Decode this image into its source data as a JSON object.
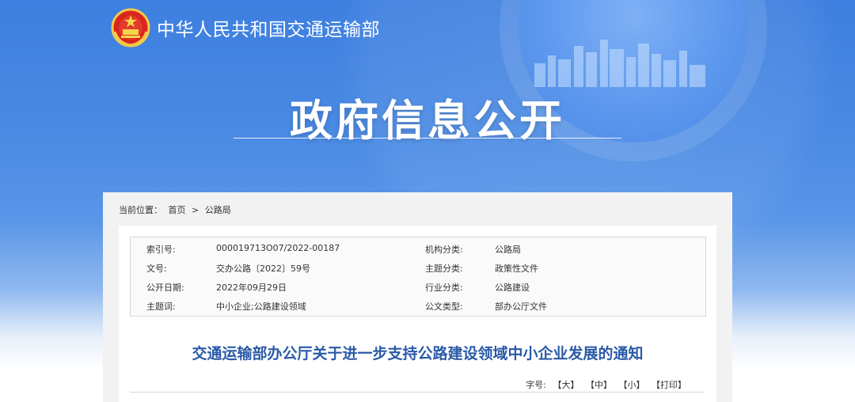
{
  "header": {
    "ministry": "中华人民共和国交通运输部",
    "banner_title": "政府信息公开"
  },
  "breadcrumb": {
    "prefix": "当前位置：",
    "home": "首页",
    "separator": ">",
    "current": "公路局"
  },
  "meta": {
    "index_label": "索引号:",
    "index_value": "000019713O07/2022-00187",
    "org_label": "机构分类:",
    "org_value": "公路局",
    "docno_label": "文号:",
    "docno_value": "交办公路〔2022〕59号",
    "theme_label": "主题分类:",
    "theme_value": "政策性文件",
    "date_label": "公开日期:",
    "date_value": "2022年09月29日",
    "industry_label": "行业分类:",
    "industry_value": "公路建设",
    "keywords_label": "主题词:",
    "keywords_value": "中小企业;公路建设领域",
    "type_label": "公文类型:",
    "type_value": "部办公厅文件"
  },
  "document": {
    "title": "交通运输部办公厅关于进一步支持公路建设领域中小企业发展的通知"
  },
  "font_controls": {
    "label": "字号:",
    "large": "【大】",
    "medium": "【中】",
    "small": "【小】",
    "print": "【打印】"
  },
  "colors": {
    "banner_blue": "#4b8be4",
    "title_blue": "#2a5aa8"
  }
}
